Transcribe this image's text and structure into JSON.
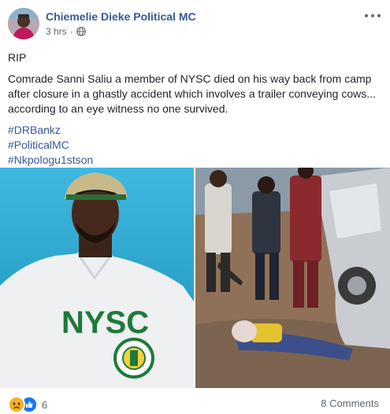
{
  "post": {
    "author": "Chiemelie Dieke Political MC",
    "time": "3 hrs",
    "separator": "·",
    "privacy_icon": "globe-icon",
    "text_rip": "RIP",
    "text_body": "Comrade Sanni Saliu a member of NYSC died on his way back from camp after closure in a ghastly accident which involves a trailer conveying cows... according to an eye witness no one survived.",
    "hashtags": [
      "#DRBankz",
      "#PoliticalMC",
      "#Nkpologu1stson"
    ]
  },
  "photos": {
    "left_shirt_text": "NYSC"
  },
  "footer": {
    "reaction_icons": [
      "sad-reaction-icon",
      "like-reaction-icon"
    ],
    "reaction_count": "6",
    "comments": "8 Comments"
  },
  "colors": {
    "link": "#385898",
    "text": "#1d2129",
    "meta": "#616770",
    "like_blue": "#1877f2",
    "sad_yellow": "#f7b125",
    "photo_bg_left": "#2aa7cf"
  }
}
